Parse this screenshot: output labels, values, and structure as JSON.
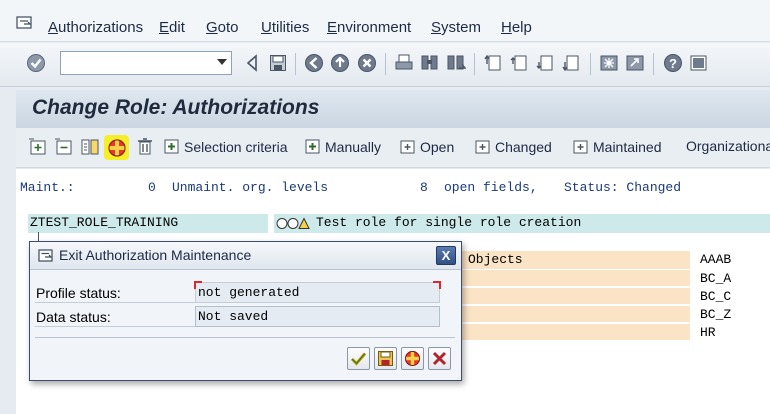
{
  "menu": {
    "items": [
      "Authorizations",
      "Edit",
      "Goto",
      "Utilities",
      "Environment",
      "System",
      "Help"
    ]
  },
  "toolbar": {
    "command_value": "",
    "icons": [
      "enter-icon",
      "back-icon",
      "save-icon",
      "back-nav-icon",
      "exit-icon",
      "cancel-icon",
      "print-icon",
      "find-icon",
      "find-next-icon",
      "first-page-icon",
      "previous-page-icon",
      "next-page-icon",
      "last-page-icon",
      "new-session-icon",
      "shortcut-icon",
      "help-icon",
      "layout-icon"
    ]
  },
  "title": "Change Role: Authorizations",
  "app_toolbar": {
    "selection_criteria": "Selection criteria",
    "manually": "Manually",
    "open": "Open",
    "changed": "Changed",
    "maintained": "Maintained",
    "organizational": "Organizational"
  },
  "status": {
    "maint_label": "Maint.:",
    "maint_value": "0",
    "unmaint_label": "Unmaint. org. levels",
    "open_value": "8",
    "open_label": "open fields,",
    "status_label": "Status: Changed"
  },
  "role": {
    "name": "ZTEST_ROLE_TRAINING",
    "description": "Test role for single role creation"
  },
  "objects_label": "Objects",
  "org_codes": [
    "AAAB",
    "BC_A",
    "BC_C",
    "BC_Z",
    "HR"
  ],
  "dialog": {
    "title": "Exit Authorization Maintenance",
    "close": "X",
    "profile_label": "Profile status:",
    "profile_value": "not generated",
    "data_label": "Data status:",
    "data_value": "Not saved"
  },
  "colors": {
    "accent": "#2f4f85",
    "status_text": "#1a3a7a",
    "role_bar": "#cde9ea",
    "org_bar": "#fbe3c6",
    "highlight": "#f5ef2a"
  }
}
